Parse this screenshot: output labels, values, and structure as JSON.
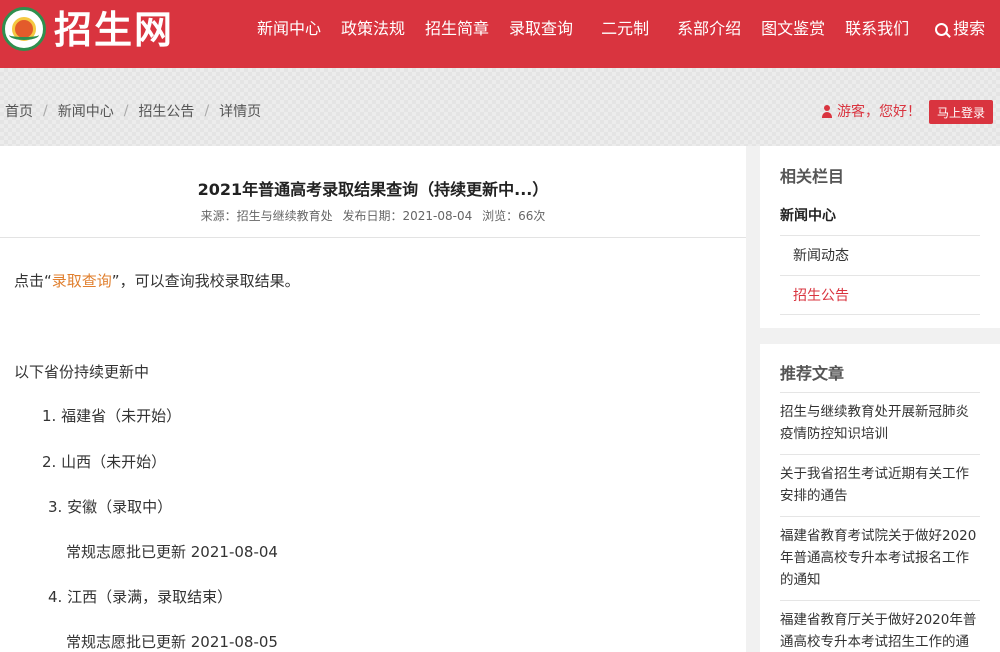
{
  "header": {
    "site_name": "招生网",
    "nav": [
      "新闻中心",
      "政策法规",
      "招生简章",
      "录取查询",
      "二元制",
      "系部介绍",
      "图文鉴赏",
      "联系我们"
    ],
    "search_label": "搜索"
  },
  "breadcrumb": [
    "首页",
    "新闻中心",
    "招生公告",
    "详情页"
  ],
  "user": {
    "greeting": "游客，您好！",
    "login_label": "马上登录"
  },
  "article": {
    "title": "2021年普通高考录取结果查询（持续更新中...）",
    "source": "来源：招生与继续教育处",
    "date": "发布日期：2021-08-04",
    "views": "浏览：66次",
    "intro_prefix": "点击“",
    "intro_link": "录取查询",
    "intro_suffix": "”，可以查询我校录取结果。",
    "lines": [
      "以下省份持续更新中",
      "1. 福建省（未开始）",
      "2. 山西（未开始）",
      "3. 安徽（录取中）",
      "常规志愿批已更新 2021-08-04",
      "4. 江西（录满，录取结束）",
      "常规志愿批已更新 2021-08-05"
    ]
  },
  "sidebar": {
    "related_title": "相关栏目",
    "related_items": [
      "新闻中心",
      "新闻动态",
      "招生公告"
    ],
    "recommend_title": "推荐文章",
    "recommend_items": [
      [
        "招生与继续教育处开展新冠肺炎",
        "疫情防控知识培训"
      ],
      [
        "关于我省招生考试近期有关工作",
        "安排的通告"
      ],
      [
        "福建省教育考试院关于做好2020",
        "年普通高校专升本考试报名工作",
        "的通知"
      ],
      [
        "福建省教育厅关于做好2020年普",
        "通高校专升本考试招生工作的通"
      ]
    ]
  },
  "colors": {
    "brand_red": "#d9343f",
    "link_orange": "#e07f2e"
  }
}
